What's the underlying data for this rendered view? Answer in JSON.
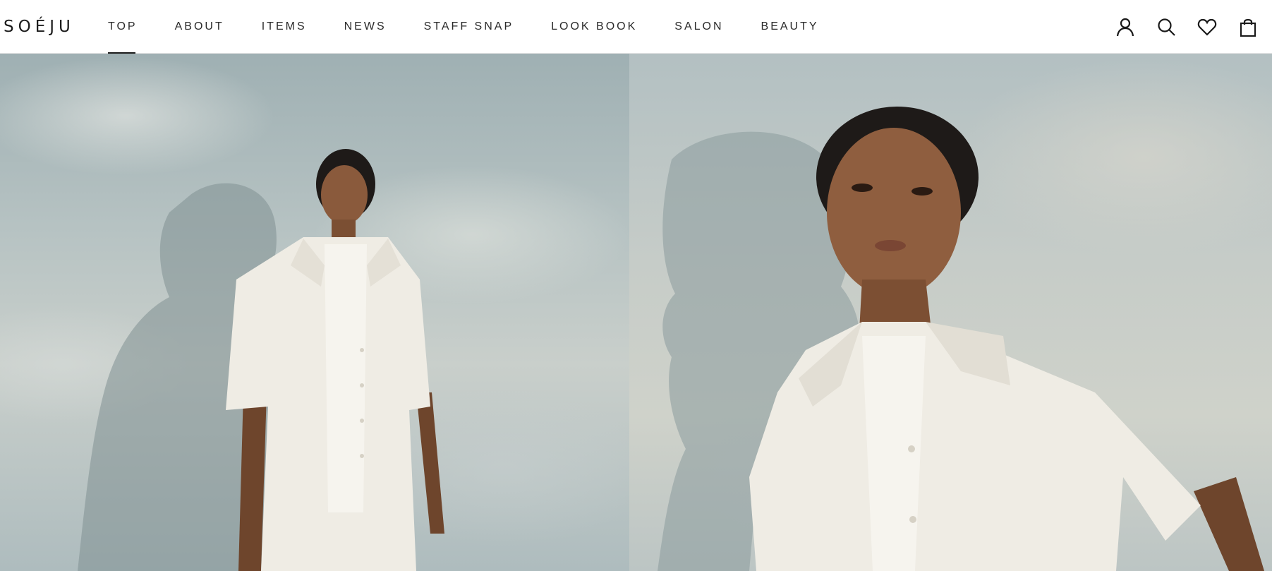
{
  "brand": {
    "logo_text": "SOÉJU"
  },
  "nav": {
    "items": [
      {
        "label": "TOP",
        "active": true
      },
      {
        "label": "ABOUT",
        "active": false
      },
      {
        "label": "ITEMS",
        "active": false
      },
      {
        "label": "NEWS",
        "active": false
      },
      {
        "label": "STAFF SNAP",
        "active": false
      },
      {
        "label": "LOOK BOOK",
        "active": false
      },
      {
        "label": "SALON",
        "active": false
      },
      {
        "label": "BEAUTY",
        "active": false
      }
    ]
  },
  "header_icons": [
    {
      "name": "account-icon"
    },
    {
      "name": "search-icon"
    },
    {
      "name": "wishlist-heart-icon"
    },
    {
      "name": "cart-bag-icon"
    }
  ],
  "hero": {
    "images": [
      {
        "name": "hero-image-left",
        "subject": "model-full-body-white-shirt"
      },
      {
        "name": "hero-image-right",
        "subject": "model-portrait-white-shirt"
      }
    ]
  },
  "colors": {
    "text": "#1c1c1c",
    "header_bg": "#ffffff",
    "sky_blue_grey": "#b7c3c3",
    "shirt_white": "#efece4",
    "skin": "#8a5a3c",
    "hair": "#1e1a18"
  }
}
